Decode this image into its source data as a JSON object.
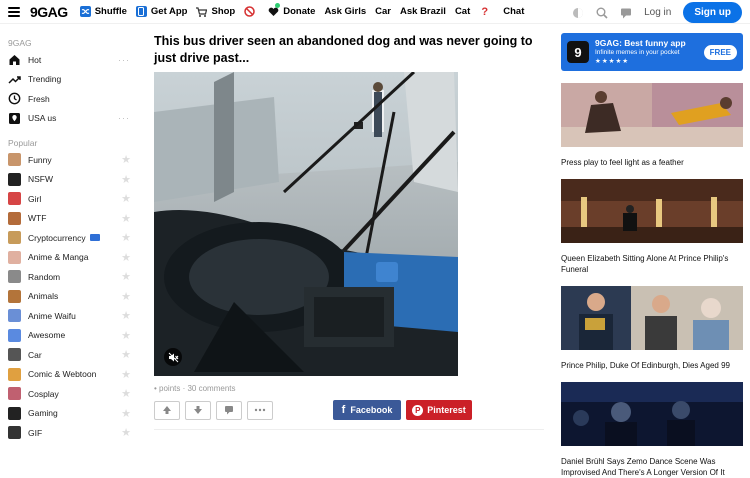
{
  "brand": {
    "logo": "9GAG"
  },
  "nav": [
    {
      "label": "Shuffle",
      "icon": "shuffle-icon",
      "color": "#1a6fd6"
    },
    {
      "label": "Get App",
      "icon": "phone-icon",
      "color": "#1a6fd6"
    },
    {
      "label": "Shop",
      "icon": "cart-icon",
      "color": "#333333"
    },
    {
      "label": "",
      "icon": "no-sign-icon",
      "color": "#d63031"
    },
    {
      "label": "Donate",
      "icon": "heart-icon",
      "color": "#111111"
    },
    {
      "label": "Ask Girls",
      "icon": "",
      "color": ""
    },
    {
      "label": "Car",
      "icon": "",
      "color": ""
    },
    {
      "label": "Ask Brazil",
      "icon": "",
      "color": ""
    },
    {
      "label": "Cat",
      "icon": "",
      "color": ""
    },
    {
      "label": "",
      "icon": "question-icon",
      "color": "#d63031"
    },
    {
      "label": "Chat",
      "icon": "",
      "color": ""
    }
  ],
  "auth": {
    "login": "Log in",
    "signup": "Sign up"
  },
  "sidebar": {
    "section_main": "9GAG",
    "main_items": [
      {
        "label": "Hot",
        "icon": "home-icon",
        "more": "···"
      },
      {
        "label": "Trending",
        "icon": "trending-icon",
        "more": ""
      },
      {
        "label": "Fresh",
        "icon": "clock-icon",
        "more": ""
      },
      {
        "label": "USA us",
        "icon": "location-icon",
        "more": "···"
      }
    ],
    "section_popular": "Popular",
    "popular_items": [
      {
        "label": "Funny",
        "icon": "funny-icon",
        "color": "#c8956b"
      },
      {
        "label": "NSFW",
        "icon": "nsfw-icon",
        "color": "#222222"
      },
      {
        "label": "Girl",
        "icon": "girl-icon",
        "color": "#d64545"
      },
      {
        "label": "WTF",
        "icon": "wtf-icon",
        "color": "#b36b3a"
      },
      {
        "label": "Cryptocurrency",
        "icon": "crypto-icon",
        "color": "#c79b5a"
      },
      {
        "label": "Anime & Manga",
        "icon": "anime-icon",
        "color": "#e0b0a0"
      },
      {
        "label": "Random",
        "icon": "random-icon",
        "color": "#8a8a8a"
      },
      {
        "label": "Animals",
        "icon": "animals-icon",
        "color": "#b3743a"
      },
      {
        "label": "Anime Waifu",
        "icon": "waifu-icon",
        "color": "#6a8fd6"
      },
      {
        "label": "Awesome",
        "icon": "awesome-icon",
        "color": "#5a8ae0"
      },
      {
        "label": "Car",
        "icon": "car-icon",
        "color": "#555555"
      },
      {
        "label": "Comic & Webtoon",
        "icon": "comic-icon",
        "color": "#e0a040"
      },
      {
        "label": "Cosplay",
        "icon": "cosplay-icon",
        "color": "#c06070"
      },
      {
        "label": "Gaming",
        "icon": "gaming-icon",
        "color": "#222222"
      },
      {
        "label": "GIF",
        "icon": "gif-icon",
        "color": "#333333"
      }
    ]
  },
  "post": {
    "title": "This bus driver seen an abandoned dog and was never going to just drive past...",
    "meta": "• points · 30 comments",
    "share_facebook": "Facebook",
    "share_pinterest": "Pinterest"
  },
  "promo": {
    "title": "9GAG: Best funny app",
    "subtitle": "Infinite memes in your pocket",
    "stars": "★★★★★",
    "cta": "FREE"
  },
  "featured": [
    {
      "caption": "Press play to feel light as a feather"
    },
    {
      "caption": "Queen Elizabeth Sitting Alone At Prince Philip's Funeral"
    },
    {
      "caption": "Prince Philip, Duke Of Edinburgh, Dies Aged 99"
    },
    {
      "caption": "Daniel Brühl Says Zemo Dance Scene Was Improvised And There's A Longer Version Of It"
    }
  ]
}
